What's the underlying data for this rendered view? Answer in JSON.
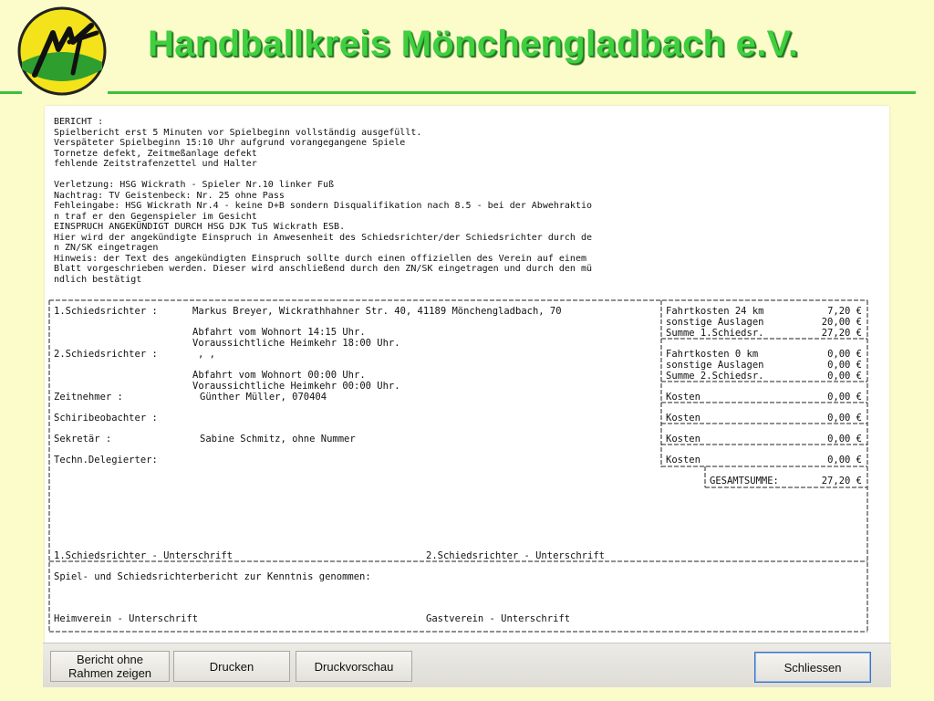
{
  "header": {
    "title": "Handballkreis Mönchengladbach e.V.",
    "logo_text": "MT"
  },
  "colors": {
    "background": "#fcfccb",
    "title_green": "#3fcf3f",
    "logo_yellow": "#f4e31b",
    "logo_green": "#2e9e2e"
  },
  "report": {
    "lines": [
      "BERICHT :",
      "Spielbericht erst 5 Minuten vor Spielbeginn vollständig ausgefüllt.",
      "Verspäteter Spielbeginn 15:10 Uhr aufgrund vorangegangene Spiele",
      "Tornetze defekt, Zeitmeßanlage defekt",
      "fehlende Zeitstrafenzettel und Halter",
      "",
      "Verletzung: HSG Wickrath - Spieler Nr.10 linker Fuß",
      "Nachtrag: TV Geistenbeck: Nr. 25 ohne Pass",
      "Fehleingabe: HSG Wickrath Nr.4 - keine D+B sondern Disqualifikation nach 8.5 - bei der Abwehraktio",
      "n traf er den Gegenspieler im Gesicht",
      "EINSPRUCH ANGEKÜNDIGT DURCH HSG DJK TuS Wickrath ESB.",
      "Hier wird der angekündigte Einspruch in Anwesenheit des Schiedsrichter/der Schiedsrichter durch de",
      "n ZN/SK eingetragen",
      "Hinweis: der Text des angekündigten Einspruch sollte durch einen offiziellen des Verein auf einem",
      "Blatt vorgeschrieben werden. Dieser wird anschließend durch den ZN/SK eingetragen und durch den mü",
      "ndlich bestätigt"
    ]
  },
  "officials": {
    "sr1_label": "1.Schiedsrichter :",
    "sr1_value": "Markus Breyer, Wickrathhahner Str. 40, 41189 Mönchengladbach, 70",
    "sr1_departure": "Abfahrt vom Wohnort 14:15 Uhr.",
    "sr1_return": "Voraussichtliche Heimkehr 18:00 Uhr.",
    "sr2_label": "2.Schiedsrichter :",
    "sr2_value": ", ,",
    "sr2_departure": "Abfahrt vom Wohnort 00:00 Uhr.",
    "sr2_return": "Voraussichtliche Heimkehr 00:00 Uhr.",
    "timekeeper_label": "Zeitnehmer :",
    "timekeeper_value": "Günther Müller, 070404",
    "scorer_observer_label": "Schiribeobachter :",
    "secretary_label": "Sekretär :",
    "secretary_value": "Sabine Schmitz, ohne Nummer",
    "tech_delegate_label": "Techn.Delegierter:"
  },
  "costs": {
    "sr1": [
      {
        "label": "Fahrtkosten 24 km",
        "amount": "7,20 €"
      },
      {
        "label": "sonstige Auslagen",
        "amount": "20,00 €"
      },
      {
        "label": "Summe 1.Schiedsr.",
        "amount": "27,20 €"
      }
    ],
    "sr2": [
      {
        "label": "Fahrtkosten 0 km",
        "amount": "0,00 €"
      },
      {
        "label": "sonstige Auslagen",
        "amount": "0,00 €"
      },
      {
        "label": "Summe 2.Schiedsr.",
        "amount": "0,00 €"
      }
    ],
    "timekeeper": {
      "label": "Kosten",
      "amount": "0,00 €"
    },
    "observer": {
      "label": "Kosten",
      "amount": "0,00 €"
    },
    "secretary": {
      "label": "Kosten",
      "amount": "0,00 €"
    },
    "delegate": {
      "label": "Kosten",
      "amount": "0,00 €"
    },
    "total_label": "GESAMTSUMME:",
    "total_amount": "27,20 €"
  },
  "signatures": {
    "sr1": "1.Schiedsrichter - Unterschrift",
    "sr2": "2.Schiedsrichter - Unterschrift",
    "acknowledged": "Spiel- und Schiedsrichterbericht zur Kenntnis genommen:",
    "home": "Heimverein - Unterschrift",
    "guest": "Gastverein - Unterschrift"
  },
  "toolbar": {
    "show_without_frame": "Bericht ohne Rahmen zeigen",
    "print": "Drucken",
    "preview": "Druckvorschau",
    "close": "Schliessen"
  }
}
